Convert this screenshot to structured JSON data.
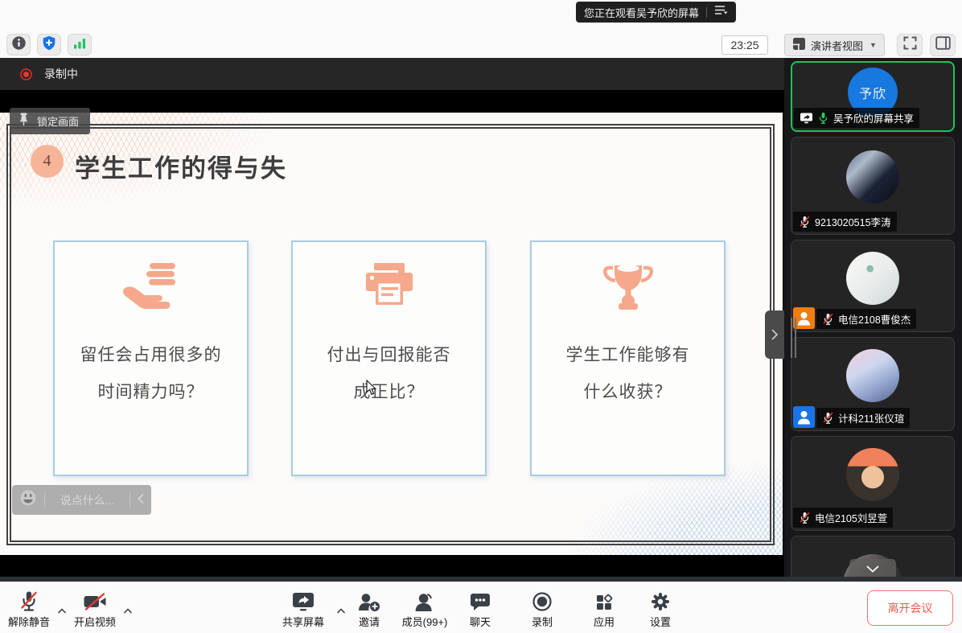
{
  "banner": {
    "text": "您正在观看吴予欣的屏幕"
  },
  "top_toolbar": {
    "time": "23:25",
    "view_mode_label": "演讲者视图",
    "icons": [
      "info-icon",
      "security-shield-icon",
      "network-signal-icon",
      "fullscreen-icon",
      "side-panel-icon"
    ]
  },
  "recording_label": "录制中",
  "pin_label": "锁定画面",
  "slide": {
    "badge_number": "4",
    "title": "学生工作的得与失",
    "cards": [
      {
        "icon": "hand-coins-icon",
        "line1": "留任会占用很多的",
        "line2": "时间精力吗？"
      },
      {
        "icon": "printer-icon",
        "line1": "付出与回报能否",
        "line2": "成正比？"
      },
      {
        "icon": "trophy-icon",
        "line1": "学生工作能够有",
        "line2": "什么收获？"
      }
    ]
  },
  "chat_pill": {
    "placeholder": "说点什么..."
  },
  "participants": [
    {
      "name": "吴予欣的屏幕共享",
      "avatar_text": "予欣",
      "screen_sharing": true,
      "mic": "on"
    },
    {
      "name": "9213020515李涛",
      "mic": "muted"
    },
    {
      "name": "电信2108曹俊杰",
      "mic": "muted",
      "badge": "orange"
    },
    {
      "name": "计科211张仪瑄",
      "mic": "muted",
      "badge": "blue"
    },
    {
      "name": "电信2105刘昱萱",
      "mic": "muted"
    },
    {
      "name": "",
      "partial": true
    }
  ],
  "bottom_toolbar": {
    "unmute": "解除静音",
    "start_video": "开启视频",
    "share_screen": "共享屏幕",
    "invite": "邀请",
    "members": "成员(99+)",
    "chat": "聊天",
    "record": "录制",
    "apps": "应用",
    "settings": "设置",
    "leave": "离开会议"
  },
  "colors": {
    "active_border_green": "#21c05b",
    "mic_on_green": "#2ec964",
    "muted_slash_red": "#e23b30",
    "record_dot_red": "#e53935",
    "leave_red": "#ee5951",
    "shield_blue": "#1a73e8",
    "badge_orange": "#ef7d14",
    "badge_blue": "#1a73e8",
    "slide_peach": "#f5a88b",
    "card_border_blue": "#a9cbe2",
    "avatar_blue": "#1778e0"
  }
}
